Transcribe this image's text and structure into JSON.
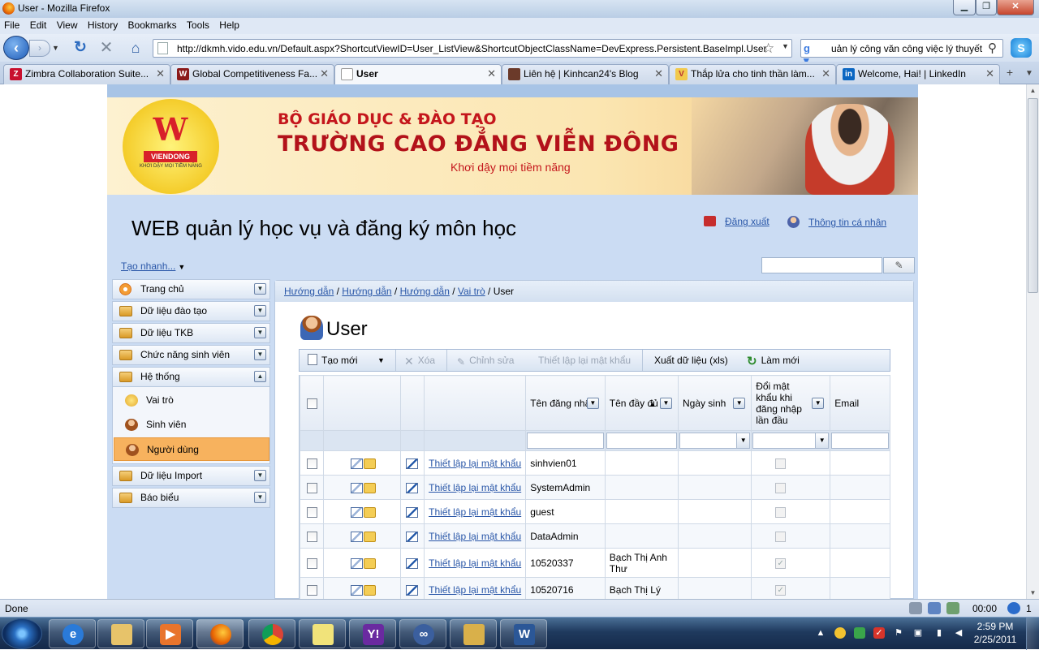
{
  "window": {
    "title": "User - Mozilla Firefox"
  },
  "menu": [
    "File",
    "Edit",
    "View",
    "History",
    "Bookmarks",
    "Tools",
    "Help"
  ],
  "nav": {
    "url": "http://dkmh.vido.edu.vn/Default.aspx?ShortcutViewID=User_ListView&ShortcutObjectClassName=DevExpress.Persistent.BaseImpl.User",
    "search_text": "uản lý công văn công việc lý thuyết"
  },
  "tabs": [
    {
      "label": "Zimbra Collaboration Suite...",
      "active": false
    },
    {
      "label": "Global Competitiveness Fa...",
      "active": false
    },
    {
      "label": "User",
      "active": true
    },
    {
      "label": "Liên hệ | Kinhcan24's Blog",
      "active": false
    },
    {
      "label": "Thắp lửa cho tinh thần làm...",
      "active": false
    },
    {
      "label": "Welcome, Hai! | LinkedIn",
      "active": false
    }
  ],
  "banner": {
    "logo_name": "VIENDONG",
    "logo_slogan": "KHƠI DẬY MỌI TIỀM NĂNG",
    "ministry": "BỘ GIÁO DỤC & ĐÀO TẠO",
    "school": "TRƯỜNG CAO ĐẲNG VIỄN ĐÔNG",
    "motto": "Khơi dậy mọi tiềm năng"
  },
  "app": {
    "title": "WEB quản lý học vụ và đăng ký môn học",
    "logout": "Đăng xuất",
    "profile": "Thông tin cá nhân",
    "quick_create": "Tạo nhanh..."
  },
  "sidebar": {
    "items": [
      {
        "label": "Trang chủ"
      },
      {
        "label": "Dữ liệu đào tạo"
      },
      {
        "label": "Dữ liệu TKB"
      },
      {
        "label": "Chức năng sinh viên"
      },
      {
        "label": "Hệ thống"
      },
      {
        "label": "Dữ liệu Import"
      },
      {
        "label": "Báo biểu"
      }
    ],
    "sub_items": [
      {
        "label": "Vai trò"
      },
      {
        "label": "Sinh viên"
      },
      {
        "label": "Người dùng",
        "active": true
      }
    ]
  },
  "breadcrumb": [
    "Hướng dẫn",
    "Hướng dẫn",
    "Hướng dẫn",
    "Vai trò",
    "User"
  ],
  "page": {
    "heading": "User"
  },
  "toolbar": {
    "new": "Tạo mới",
    "delete": "Xóa",
    "edit": "Chỉnh sửa",
    "reset_password": "Thiết lập lại mật khẩu",
    "export": "Xuất dữ liệu (xls)",
    "refresh": "Làm mới"
  },
  "grid": {
    "columns": [
      "Tên đăng nhập",
      "Tên đầy đủ",
      "Ngày sinh",
      "Đổi mật khẩu khi đăng nhập lần đầu",
      "Email"
    ],
    "reset_link": "Thiết lập lại mật khẩu",
    "rows": [
      {
        "username": "sinhvien01",
        "fullname": "",
        "dob": "",
        "change_pw": false
      },
      {
        "username": "SystemAdmin",
        "fullname": "",
        "dob": "",
        "change_pw": false
      },
      {
        "username": "guest",
        "fullname": "",
        "dob": "",
        "change_pw": false
      },
      {
        "username": "DataAdmin",
        "fullname": "",
        "dob": "",
        "change_pw": false
      },
      {
        "username": "10520337",
        "fullname": "Bạch Thị Anh Thư",
        "dob": "",
        "change_pw": true
      },
      {
        "username": "10520716",
        "fullname": "Bạch Thị Lý",
        "dob": "",
        "change_pw": true
      }
    ]
  },
  "status": {
    "text": "Done",
    "timer": "00:00",
    "count": "1"
  },
  "clock": {
    "time": "2:59 PM",
    "date": "2/25/2011"
  }
}
